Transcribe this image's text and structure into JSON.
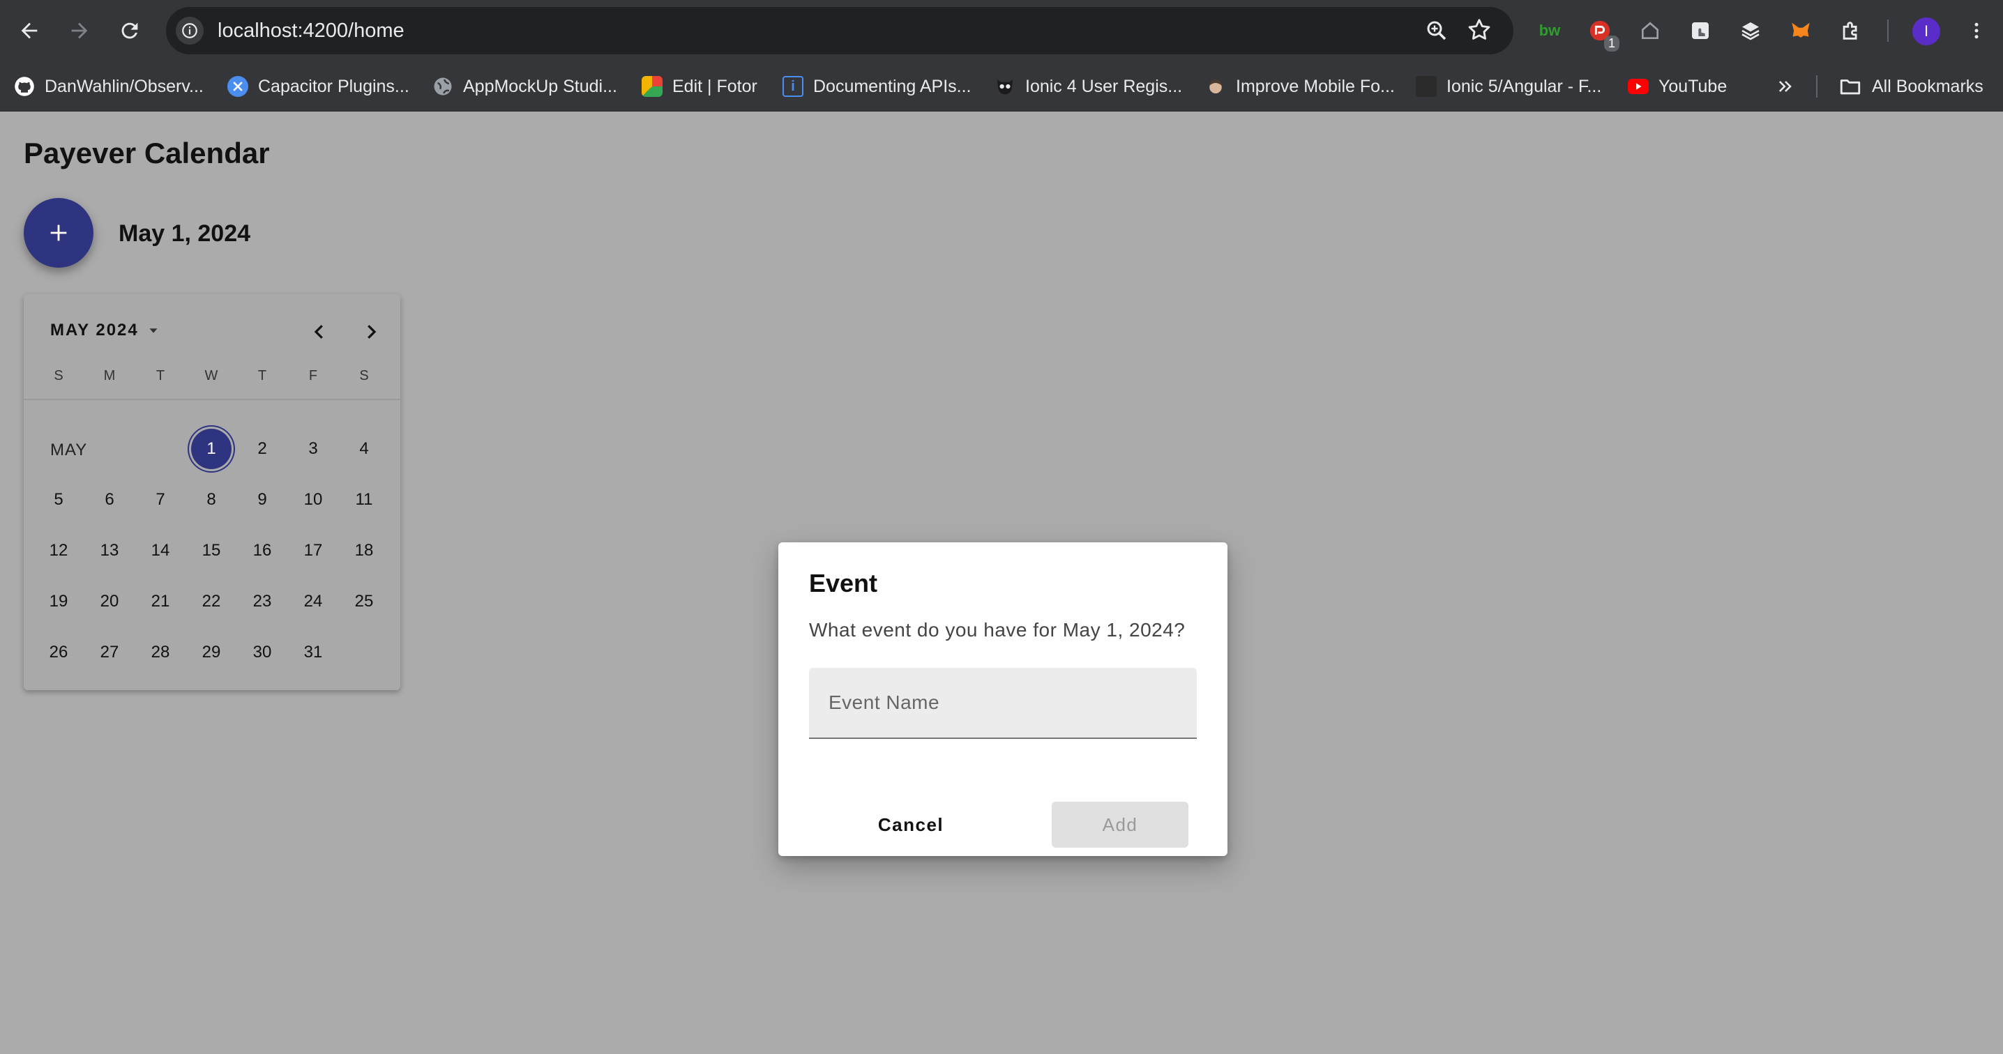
{
  "browser": {
    "url": "localhost:4200/home",
    "extensions": [
      {
        "name": "bitwarden",
        "label": "bw",
        "color": "#2f9e2f"
      },
      {
        "name": "red-extension",
        "badge": "1",
        "color": "#d93025"
      },
      {
        "name": "home",
        "color": "#9aa0a6"
      },
      {
        "name": "touch",
        "color": "#e8eaed"
      },
      {
        "name": "stack",
        "color": "#e8eaed"
      },
      {
        "name": "metamask",
        "color": "#f6851b"
      },
      {
        "name": "puzzle",
        "color": "#e8eaed"
      }
    ],
    "profile_initial": "I"
  },
  "bookmarks": {
    "items": [
      {
        "label": "DanWahlin/Observ...",
        "icon": "github-icon",
        "color": "#ffffff"
      },
      {
        "label": "Capacitor Plugins...",
        "icon": "capacitor-icon",
        "color": "#4a8ef0"
      },
      {
        "label": "AppMockUp Studi...",
        "icon": "globe-icon",
        "color": "#9aa0a6"
      },
      {
        "label": "Edit | Fotor",
        "icon": "fotor-icon",
        "color": "#f2b400"
      },
      {
        "label": "Documenting APIs...",
        "icon": "doc-icon",
        "color": "#4a8ef0"
      },
      {
        "label": "Ionic 4 User Regis...",
        "icon": "owl-icon",
        "color": "#202124"
      },
      {
        "label": "Improve Mobile Fo...",
        "icon": "face-icon",
        "color": "#d8b79a"
      },
      {
        "label": "Ionic 5/Angular - F...",
        "icon": "dark-icon",
        "color": "#2a2a2a"
      },
      {
        "label": "YouTube",
        "icon": "youtube-icon",
        "color": "#ff0000"
      }
    ],
    "all_bookmarks": "All Bookmarks"
  },
  "page": {
    "title": "Payever Calendar",
    "selected_date": "May 1, 2024"
  },
  "calendar": {
    "header": "MAY 2024",
    "weekdays": [
      "S",
      "M",
      "T",
      "W",
      "T",
      "F",
      "S"
    ],
    "month_label": "MAY",
    "first_weekday": 3,
    "days_in_month": 31,
    "selected_day": 1
  },
  "dialog": {
    "title": "Event",
    "message": "What event do you have for May 1, 2024?",
    "input_placeholder": "Event Name",
    "input_value": "",
    "cancel_label": "Cancel",
    "add_label": "Add"
  },
  "colors": {
    "primary": "#2f3480",
    "backdrop": "#ababab"
  }
}
